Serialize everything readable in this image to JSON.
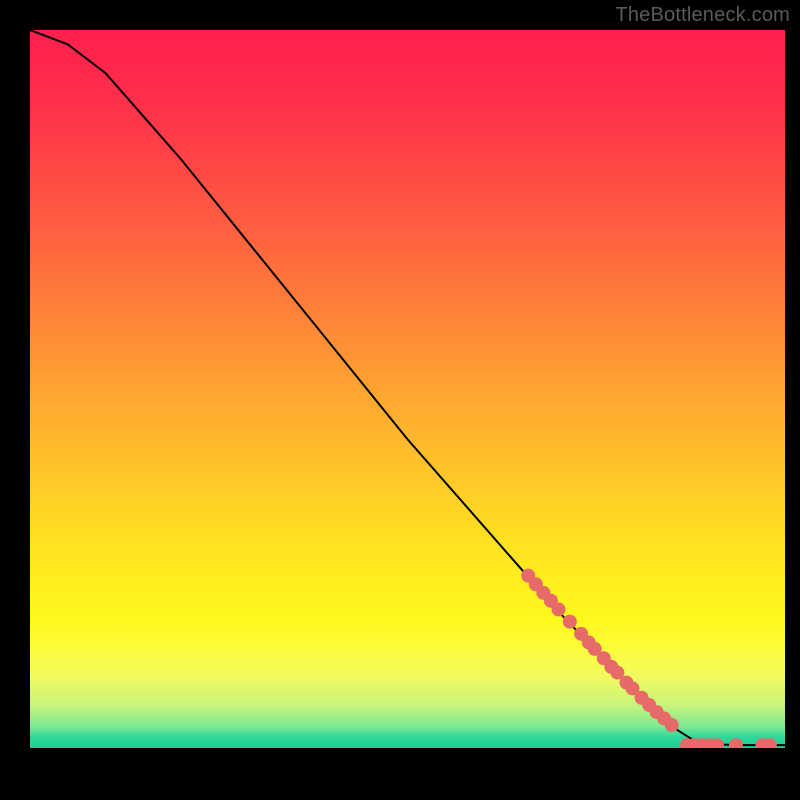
{
  "watermark": "TheBottleneck.com",
  "chart_data": {
    "type": "line",
    "title": "",
    "xlabel": "",
    "ylabel": "",
    "xlim": [
      0,
      100
    ],
    "ylim": [
      0,
      100
    ],
    "grid": false,
    "curve": [
      {
        "x": 0,
        "y": 100
      },
      {
        "x": 5,
        "y": 98
      },
      {
        "x": 10,
        "y": 94
      },
      {
        "x": 15,
        "y": 88
      },
      {
        "x": 20,
        "y": 82
      },
      {
        "x": 30,
        "y": 69
      },
      {
        "x": 40,
        "y": 56
      },
      {
        "x": 50,
        "y": 43
      },
      {
        "x": 60,
        "y": 31
      },
      {
        "x": 70,
        "y": 19
      },
      {
        "x": 80,
        "y": 8
      },
      {
        "x": 85,
        "y": 3
      },
      {
        "x": 88,
        "y": 1
      },
      {
        "x": 90,
        "y": 0.5
      },
      {
        "x": 95,
        "y": 0.4
      },
      {
        "x": 100,
        "y": 0.4
      }
    ],
    "markers": [
      {
        "x": 66,
        "y": 24.0
      },
      {
        "x": 67,
        "y": 22.8
      },
      {
        "x": 68,
        "y": 21.6
      },
      {
        "x": 69,
        "y": 20.5
      },
      {
        "x": 70,
        "y": 19.3
      },
      {
        "x": 71.5,
        "y": 17.6
      },
      {
        "x": 73,
        "y": 15.9
      },
      {
        "x": 74,
        "y": 14.7
      },
      {
        "x": 74.8,
        "y": 13.8
      },
      {
        "x": 76,
        "y": 12.5
      },
      {
        "x": 77,
        "y": 11.3
      },
      {
        "x": 77.8,
        "y": 10.5
      },
      {
        "x": 79,
        "y": 9.1
      },
      {
        "x": 79.8,
        "y": 8.3
      },
      {
        "x": 81,
        "y": 7.0
      },
      {
        "x": 82,
        "y": 6.0
      },
      {
        "x": 83,
        "y": 5.0
      },
      {
        "x": 84,
        "y": 4.1
      },
      {
        "x": 85,
        "y": 3.2
      },
      {
        "x": 87,
        "y": 0.4
      },
      {
        "x": 88,
        "y": 0.4
      },
      {
        "x": 89,
        "y": 0.4
      },
      {
        "x": 90,
        "y": 0.4
      },
      {
        "x": 91,
        "y": 0.4
      },
      {
        "x": 93.5,
        "y": 0.4
      },
      {
        "x": 97,
        "y": 0.4
      },
      {
        "x": 98,
        "y": 0.4
      }
    ],
    "marker_color": "#e66a68",
    "curve_color": "#000000",
    "background": "rainbow-vertical"
  }
}
